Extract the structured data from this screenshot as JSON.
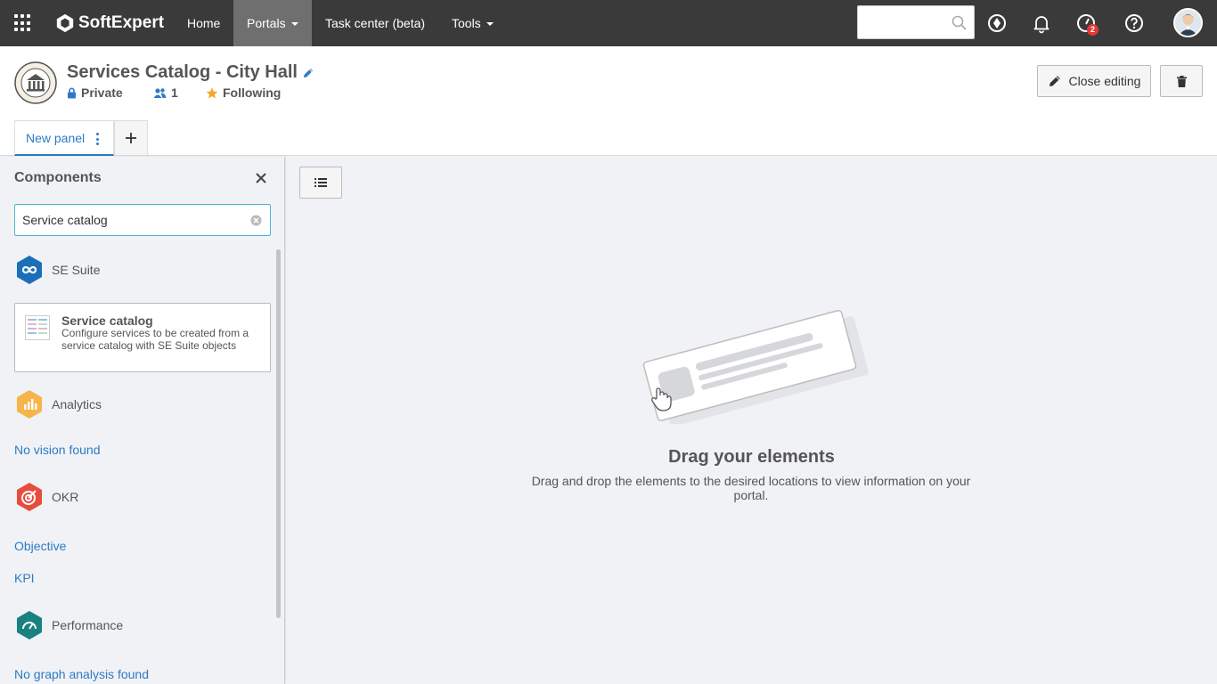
{
  "topbar": {
    "brand": "SoftExpert",
    "nav": [
      {
        "label": "Home"
      },
      {
        "label": "Portals"
      },
      {
        "label": "Task center (beta)"
      },
      {
        "label": "Tools"
      }
    ],
    "search_placeholder": "",
    "notifications_badge": "2",
    "bg_color": "#3a3a3a"
  },
  "header": {
    "title": "Services Catalog - City Hall",
    "visibility": "Private",
    "members": "1",
    "following": "Following",
    "close_editing_label": "Close editing",
    "tab_label": "New panel",
    "accent_color": "#2d7bc4"
  },
  "sidebar": {
    "title": "Components",
    "search_value": "Service catalog",
    "groups": {
      "suite": "SE Suite",
      "analytics": "Analytics",
      "okr": "OKR",
      "performance": "Performance"
    },
    "card": {
      "title": "Service catalog",
      "description": "Configure services to be created from a service catalog with SE Suite objects"
    },
    "links": {
      "no_vision": "No vision found",
      "objective": "Objective",
      "kpi": "KPI",
      "no_graph": "No graph analysis found"
    }
  },
  "main": {
    "drag_title": "Drag your elements",
    "drag_description": "Drag and drop the elements to the desired locations to view information on your portal."
  }
}
